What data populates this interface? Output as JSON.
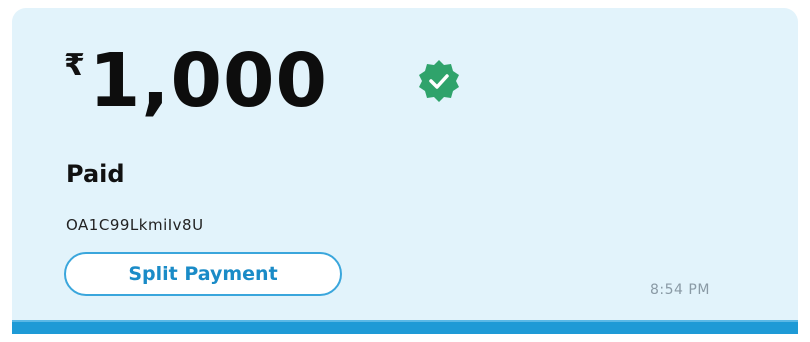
{
  "payment": {
    "currency_symbol": "₹",
    "amount": "1,000",
    "status": "Paid",
    "transaction_id": "OA1C99LkmiIv8U",
    "split_button_label": "Split Payment",
    "time": "8:54 PM"
  },
  "colors": {
    "card_background": "#e2f3fb",
    "verified_badge": "#2fa36b",
    "accent": "#1a8bc7",
    "bottom_bar": "#1e9ad6"
  },
  "icons": {
    "verified": "verified-check-badge-icon"
  }
}
